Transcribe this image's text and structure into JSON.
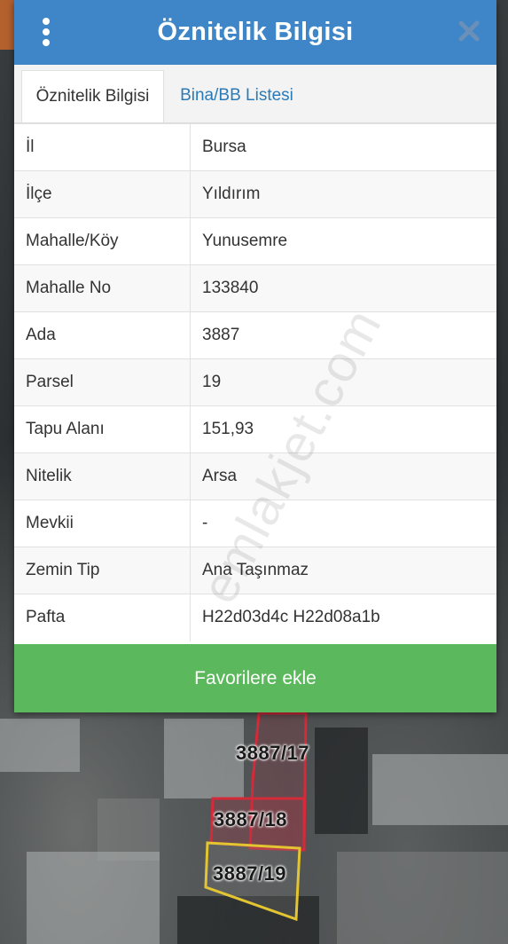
{
  "header": {
    "title": "Öznitelik Bilgisi",
    "menu_icon": "kebab-menu-icon",
    "close_icon": "close-icon"
  },
  "tabs": [
    {
      "label": "Öznitelik Bilgisi",
      "active": true
    },
    {
      "label": "Bina/BB Listesi",
      "active": false
    }
  ],
  "attributes": [
    {
      "key": "İl",
      "value": "Bursa"
    },
    {
      "key": "İlçe",
      "value": "Yıldırım"
    },
    {
      "key": "Mahalle/Köy",
      "value": "Yunusemre"
    },
    {
      "key": "Mahalle No",
      "value": "133840"
    },
    {
      "key": "Ada",
      "value": "3887"
    },
    {
      "key": "Parsel",
      "value": "19"
    },
    {
      "key": "Tapu Alanı",
      "value": "151,93"
    },
    {
      "key": "Nitelik",
      "value": "Arsa"
    },
    {
      "key": "Mevkii",
      "value": "-"
    },
    {
      "key": "Zemin Tip",
      "value": "Ana Taşınmaz"
    },
    {
      "key": "Pafta",
      "value": "H22d03d4c H22d08a1b"
    }
  ],
  "favorite_button": {
    "label": "Favorilere ekle"
  },
  "map": {
    "parcel_labels": [
      "3887/17",
      "3887/18",
      "3887/19"
    ]
  },
  "watermark": "emlakjet.com",
  "colors": {
    "header": "#3e86c7",
    "button": "#5cb85c",
    "tab_link": "#2a7ab7",
    "parcel_outline": "#d42a3a"
  }
}
